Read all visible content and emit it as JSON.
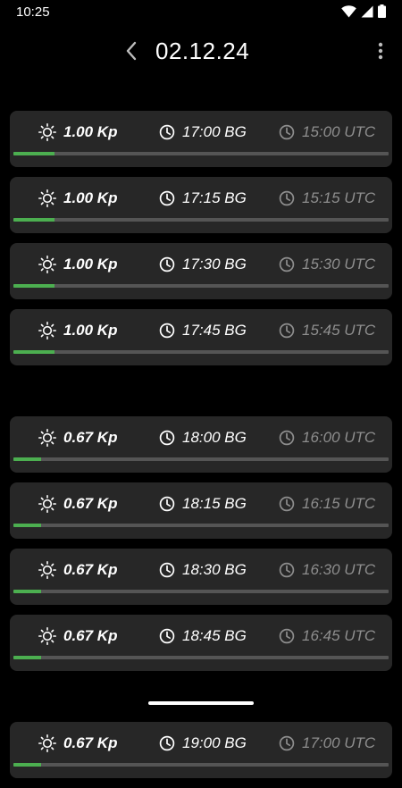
{
  "status": {
    "time": "10:25"
  },
  "header": {
    "title": "02.12.24"
  },
  "entries_group1": [
    {
      "kp": "1.00 Kp",
      "bg": "17:00 BG",
      "utc": "15:00 UTC",
      "level": 0.11
    },
    {
      "kp": "1.00 Kp",
      "bg": "17:15 BG",
      "utc": "15:15 UTC",
      "level": 0.11
    },
    {
      "kp": "1.00 Kp",
      "bg": "17:30 BG",
      "utc": "15:30 UTC",
      "level": 0.11
    },
    {
      "kp": "1.00 Kp",
      "bg": "17:45 BG",
      "utc": "15:45 UTC",
      "level": 0.11
    }
  ],
  "entries_group2": [
    {
      "kp": "0.67 Kp",
      "bg": "18:00 BG",
      "utc": "16:00 UTC",
      "level": 0.074
    },
    {
      "kp": "0.67 Kp",
      "bg": "18:15 BG",
      "utc": "16:15 UTC",
      "level": 0.074
    },
    {
      "kp": "0.67 Kp",
      "bg": "18:30 BG",
      "utc": "16:30 UTC",
      "level": 0.074
    },
    {
      "kp": "0.67 Kp",
      "bg": "18:45 BG",
      "utc": "16:45 UTC",
      "level": 0.074
    }
  ],
  "entries_group3": [
    {
      "kp": "0.67 Kp",
      "bg": "19:00 BG",
      "utc": "17:00 UTC",
      "level": 0.074
    }
  ],
  "icons": {
    "kp": "sun-icon",
    "bg": "clock-icon",
    "utc": "clock-icon",
    "back": "chevron-left-icon",
    "menu": "more-vert-icon"
  },
  "colors": {
    "background": "#000000",
    "card": "#272727",
    "progress": "#4caf50",
    "track": "#555555",
    "utc_text": "#8e8e8e"
  }
}
